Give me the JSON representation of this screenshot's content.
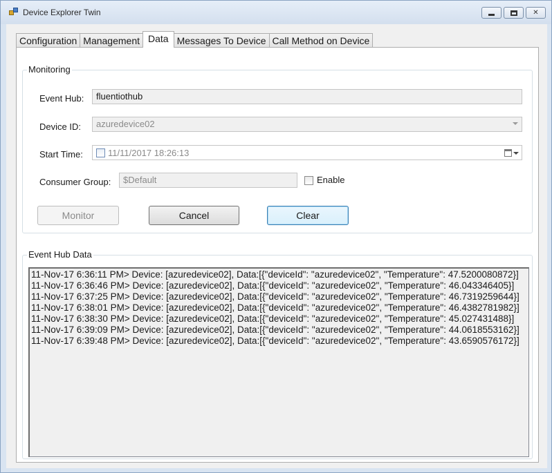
{
  "window": {
    "title": "Device Explorer Twin",
    "minimize_icon": "minimize-icon",
    "maximize_icon": "maximize-icon",
    "close_icon": "close-icon",
    "close_glyph": "✕"
  },
  "tabs": [
    {
      "label": "Configuration",
      "active": false
    },
    {
      "label": "Management",
      "active": false
    },
    {
      "label": "Data",
      "active": true
    },
    {
      "label": "Messages To Device",
      "active": false
    },
    {
      "label": "Call Method on Device",
      "active": false
    }
  ],
  "monitoring": {
    "group_label": "Monitoring",
    "event_hub_label": "Event Hub:",
    "event_hub_value": "fluentiothub",
    "device_id_label": "Device ID:",
    "device_id_value": "azuredevice02",
    "start_time_label": "Start Time:",
    "start_time_value": "11/11/2017 18:26:13",
    "consumer_group_label": "Consumer Group:",
    "consumer_group_value": "$Default",
    "enable_label": "Enable",
    "monitor_button": "Monitor",
    "cancel_button": "Cancel",
    "clear_button": "Clear"
  },
  "event_hub_data": {
    "group_label": "Event Hub Data",
    "lines": [
      "11-Nov-17 6:36:11 PM> Device: [azuredevice02], Data:[{\"deviceId\": \"azuredevice02\", \"Temperature\": 47.5200080872}]",
      "11-Nov-17 6:36:46 PM> Device: [azuredevice02], Data:[{\"deviceId\": \"azuredevice02\", \"Temperature\": 46.043346405}]",
      "11-Nov-17 6:37:25 PM> Device: [azuredevice02], Data:[{\"deviceId\": \"azuredevice02\", \"Temperature\": 46.7319259644}]",
      "11-Nov-17 6:38:01 PM> Device: [azuredevice02], Data:[{\"deviceId\": \"azuredevice02\", \"Temperature\": 46.4382781982}]",
      "11-Nov-17 6:38:30 PM> Device: [azuredevice02], Data:[{\"deviceId\": \"azuredevice02\", \"Temperature\": 45.027431488}]",
      "11-Nov-17 6:39:09 PM> Device: [azuredevice02], Data:[{\"deviceId\": \"azuredevice02\", \"Temperature\": 44.0618553162}]",
      "11-Nov-17 6:39:48 PM> Device: [azuredevice02], Data:[{\"deviceId\": \"azuredevice02\", \"Temperature\": 43.6590576172}]"
    ]
  }
}
